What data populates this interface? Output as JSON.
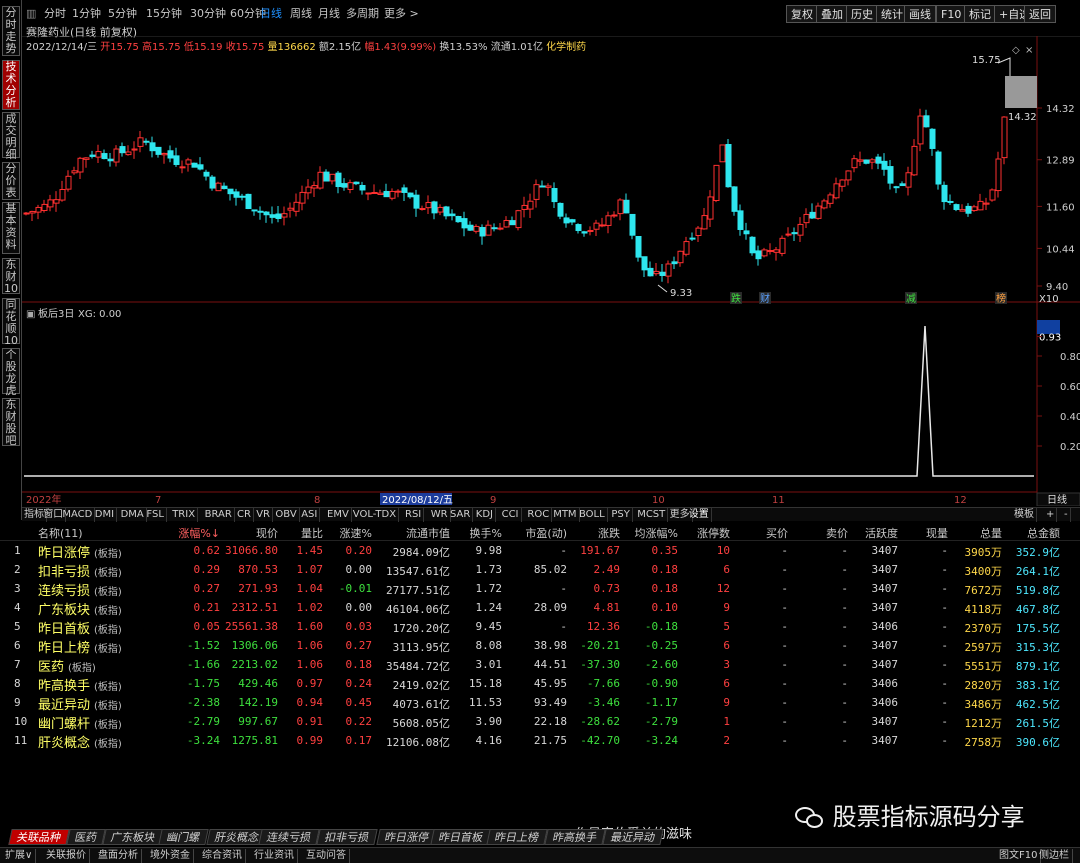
{
  "side_tabs": [
    "分时走势",
    "技术分析",
    "成交明细",
    "分价表",
    "基本资料",
    "东财10",
    "同花顺10",
    "个股龙虎",
    "东财股吧"
  ],
  "period_buttons": [
    "分时",
    "1分钟",
    "5分钟",
    "15分钟",
    "30分钟",
    "60分钟",
    "日线",
    "周线",
    "月线",
    "多周期",
    "更多 >"
  ],
  "selected_period": "日线",
  "right_buttons": [
    "复权",
    "叠加",
    "历史",
    "统计",
    "画线",
    "F10",
    "标记",
    "+自选",
    "返回"
  ],
  "stock_title": "赛隆药业(日线 前复权)",
  "quote_line": {
    "date": "2022/12/14/三",
    "open": "开15.75",
    "high": "高15.75",
    "low": "低15.19",
    "close": "收15.75",
    "volume": "量136662",
    "amount": "额2.15亿",
    "change": "幅1.43(9.99%)",
    "turnover": "换13.53%",
    "float_cap": "流通1.01亿",
    "sector": "化学制药"
  },
  "price_axis": [
    "14.32",
    "12.89",
    "11.60",
    "10.44",
    "9.40"
  ],
  "price_labels": {
    "top": "15.75",
    "right_box": "14.32",
    "low": "9.33",
    "x10": "X10"
  },
  "event_badges": [
    "跌",
    "财",
    "减",
    "榜"
  ],
  "indicator": {
    "name": "板后3日",
    "value_text": "XG: 0.00",
    "axis": [
      "0.93",
      "0.80",
      "0.60",
      "0.40",
      "0.20"
    ]
  },
  "date_axis": {
    "labels": [
      "2022年",
      "7",
      "8",
      "2022/08/12/五",
      "9",
      "10",
      "11",
      "12"
    ],
    "mode": "日线"
  },
  "indicator_tabs": [
    "指标",
    "窗口",
    "MACD",
    "DMI",
    "DMA",
    "FSL",
    "TRIX",
    "BRAR",
    "CR",
    "VR",
    "OBV",
    "ASI",
    "EMV",
    "VOL-TDX",
    "RSI",
    "WR",
    "SAR",
    "KDJ",
    "CCI",
    "ROC",
    "MTM",
    "BOLL",
    "PSY",
    "MCST",
    "更多",
    "设置"
  ],
  "indicator_tabs_right": [
    "模板",
    "+",
    "-"
  ],
  "table": {
    "headers": [
      "名称(11)",
      "涨幅%↓",
      "现价",
      "量比",
      "涨速%",
      "流通市值",
      "换手%",
      "市盈(动)",
      "涨跌",
      "均涨幅%",
      "涨停数",
      "买价",
      "卖价",
      "活跃度",
      "现量",
      "总量",
      "总金额"
    ],
    "rows": [
      {
        "no": "1",
        "name": "昨日涨停",
        "tag": "(板指)",
        "chg": "0.62",
        "price": "31066.80",
        "vr": "1.45",
        "spd": "0.20",
        "cap": "2984.09亿",
        "turn": "9.98",
        "pe": "-",
        "diff": "191.67",
        "avg": "0.35",
        "lu": "10",
        "bid": "-",
        "ask": "-",
        "act": "3407",
        "cur": "-",
        "vol": "3905万",
        "amt": "352.9亿",
        "dir": "up",
        "sdir": "up"
      },
      {
        "no": "2",
        "name": "扣非亏损",
        "tag": "(板指)",
        "chg": "0.29",
        "price": "870.53",
        "vr": "1.07",
        "spd": "0.00",
        "cap": "13547.61亿",
        "turn": "1.73",
        "pe": "85.02",
        "diff": "2.49",
        "avg": "0.18",
        "lu": "6",
        "bid": "-",
        "ask": "-",
        "act": "3407",
        "cur": "-",
        "vol": "3400万",
        "amt": "264.1亿",
        "dir": "up",
        "sdir": "flat"
      },
      {
        "no": "3",
        "name": "连续亏损",
        "tag": "(板指)",
        "chg": "0.27",
        "price": "271.93",
        "vr": "1.04",
        "spd": "-0.01",
        "cap": "27177.51亿",
        "turn": "1.72",
        "pe": "-",
        "diff": "0.73",
        "avg": "0.18",
        "lu": "12",
        "bid": "-",
        "ask": "-",
        "act": "3407",
        "cur": "-",
        "vol": "7672万",
        "amt": "519.8亿",
        "dir": "up",
        "sdir": "down"
      },
      {
        "no": "4",
        "name": "广东板块",
        "tag": "(板指)",
        "chg": "0.21",
        "price": "2312.51",
        "vr": "1.02",
        "spd": "0.00",
        "cap": "46104.06亿",
        "turn": "1.24",
        "pe": "28.09",
        "diff": "4.81",
        "avg": "0.10",
        "lu": "9",
        "bid": "-",
        "ask": "-",
        "act": "3407",
        "cur": "-",
        "vol": "4118万",
        "amt": "467.8亿",
        "dir": "up",
        "sdir": "flat"
      },
      {
        "no": "5",
        "name": "昨日首板",
        "tag": "(板指)",
        "chg": "0.05",
        "price": "25561.38",
        "vr": "1.60",
        "spd": "0.03",
        "cap": "1720.20亿",
        "turn": "9.45",
        "pe": "-",
        "diff": "12.36",
        "avg": "-0.18",
        "lu": "5",
        "bid": "-",
        "ask": "-",
        "act": "3406",
        "cur": "-",
        "vol": "2370万",
        "amt": "175.5亿",
        "dir": "up",
        "sdir": "up"
      },
      {
        "no": "6",
        "name": "昨日上榜",
        "tag": "(板指)",
        "chg": "-1.52",
        "price": "1306.06",
        "vr": "1.06",
        "spd": "0.27",
        "cap": "3113.95亿",
        "turn": "8.08",
        "pe": "38.98",
        "diff": "-20.21",
        "avg": "-0.25",
        "lu": "6",
        "bid": "-",
        "ask": "-",
        "act": "3407",
        "cur": "-",
        "vol": "2597万",
        "amt": "315.3亿",
        "dir": "down",
        "sdir": "up"
      },
      {
        "no": "7",
        "name": "医药",
        "tag": "(板指)",
        "chg": "-1.66",
        "price": "2213.02",
        "vr": "1.06",
        "spd": "0.18",
        "cap": "35484.72亿",
        "turn": "3.01",
        "pe": "44.51",
        "diff": "-37.30",
        "avg": "-2.60",
        "lu": "3",
        "bid": "-",
        "ask": "-",
        "act": "3407",
        "cur": "-",
        "vol": "5551万",
        "amt": "879.1亿",
        "dir": "down",
        "sdir": "up"
      },
      {
        "no": "8",
        "name": "昨高换手",
        "tag": "(板指)",
        "chg": "-1.75",
        "price": "429.46",
        "vr": "0.97",
        "spd": "0.24",
        "cap": "2419.02亿",
        "turn": "15.18",
        "pe": "45.95",
        "diff": "-7.66",
        "avg": "-0.90",
        "lu": "6",
        "bid": "-",
        "ask": "-",
        "act": "3406",
        "cur": "-",
        "vol": "2820万",
        "amt": "383.1亿",
        "dir": "down",
        "sdir": "up"
      },
      {
        "no": "9",
        "name": "最近异动",
        "tag": "(板指)",
        "chg": "-2.38",
        "price": "142.19",
        "vr": "0.94",
        "spd": "0.45",
        "cap": "4073.61亿",
        "turn": "11.53",
        "pe": "93.49",
        "diff": "-3.46",
        "avg": "-1.17",
        "lu": "9",
        "bid": "-",
        "ask": "-",
        "act": "3406",
        "cur": "-",
        "vol": "3486万",
        "amt": "462.5亿",
        "dir": "down",
        "sdir": "up"
      },
      {
        "no": "10",
        "name": "幽门螺杆",
        "tag": "(板指)",
        "chg": "-2.79",
        "price": "997.67",
        "vr": "0.91",
        "spd": "0.22",
        "cap": "5608.05亿",
        "turn": "3.90",
        "pe": "22.18",
        "diff": "-28.62",
        "avg": "-2.79",
        "lu": "1",
        "bid": "-",
        "ask": "-",
        "act": "3407",
        "cur": "-",
        "vol": "1212万",
        "amt": "261.5亿",
        "dir": "down",
        "sdir": "up"
      },
      {
        "no": "11",
        "name": "肝炎概念",
        "tag": "(板指)",
        "chg": "-3.24",
        "price": "1275.81",
        "vr": "0.99",
        "spd": "0.17",
        "cap": "12106.08亿",
        "turn": "4.16",
        "pe": "21.75",
        "diff": "-42.70",
        "avg": "-3.24",
        "lu": "2",
        "bid": "-",
        "ask": "-",
        "act": "3407",
        "cur": "-",
        "vol": "2758万",
        "amt": "390.6亿",
        "dir": "down",
        "sdir": "up"
      }
    ]
  },
  "bottom_tabs": [
    "关联品种",
    "医药",
    "广东板块",
    "幽门螺",
    "肝炎概念",
    "连续亏损",
    "扣非亏损",
    "昨日涨停",
    "昨日首板",
    "昨日上榜",
    "昨高换手",
    "最近异动"
  ],
  "status_items": [
    "扩展∨",
    "关联报价",
    "盘面分析",
    "境外资金",
    "综合资讯",
    "行业资讯",
    "互动问答"
  ],
  "status_right": [
    "图文F10",
    "侧边栏"
  ],
  "watermark": "股票指标源码分享",
  "quote_text": "作最富伯爵单的滋味",
  "colors": {
    "up": "#ff3030",
    "down": "#2ee6ee",
    "volume_yellow": "#ffd84a",
    "amount_cyan": "#4ee8ff",
    "selected_tab": "#c00000"
  }
}
